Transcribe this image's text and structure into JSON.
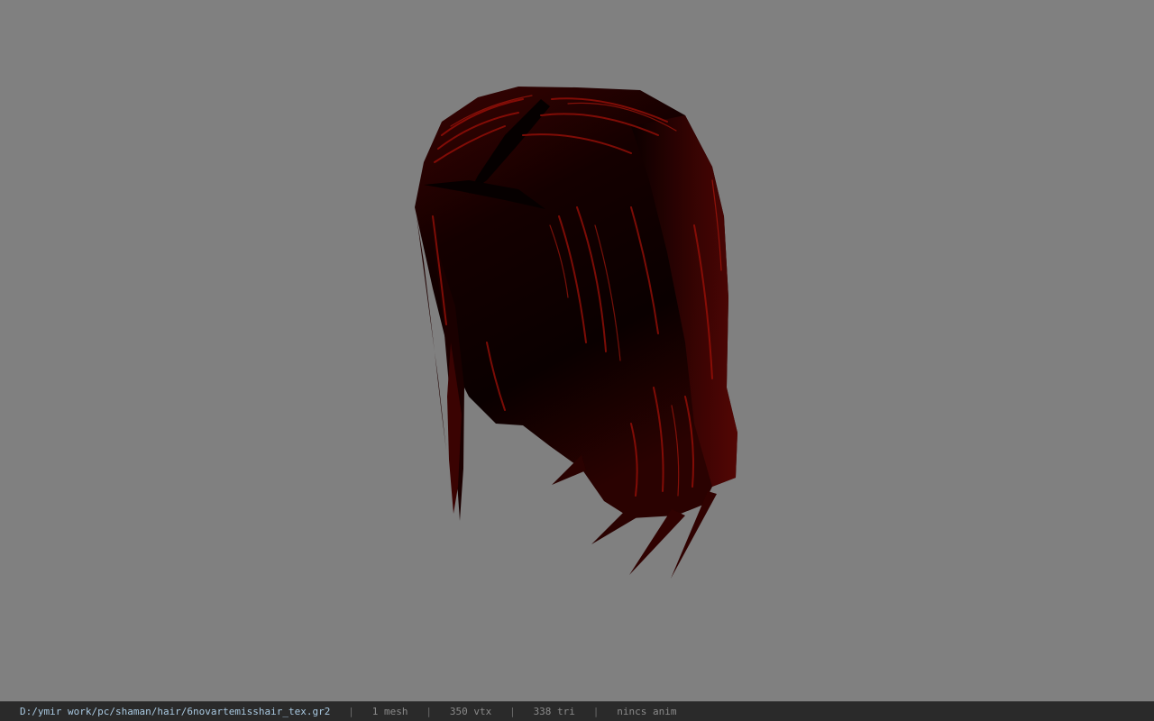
{
  "status": {
    "file_path": "D:/ymir work/pc/shaman/hair/6novartemisshair_tex.gr2",
    "mesh": "1 mesh",
    "vertices": "350 vtx",
    "triangles": "338 tri",
    "anim": "nincs anim"
  },
  "colors": {
    "background": "#808080",
    "hair_dark": "#0c0000",
    "hair_mid": "#4a0503",
    "hair_highlight": "#b0140a"
  },
  "viewport": {
    "model": "hair-mesh"
  }
}
